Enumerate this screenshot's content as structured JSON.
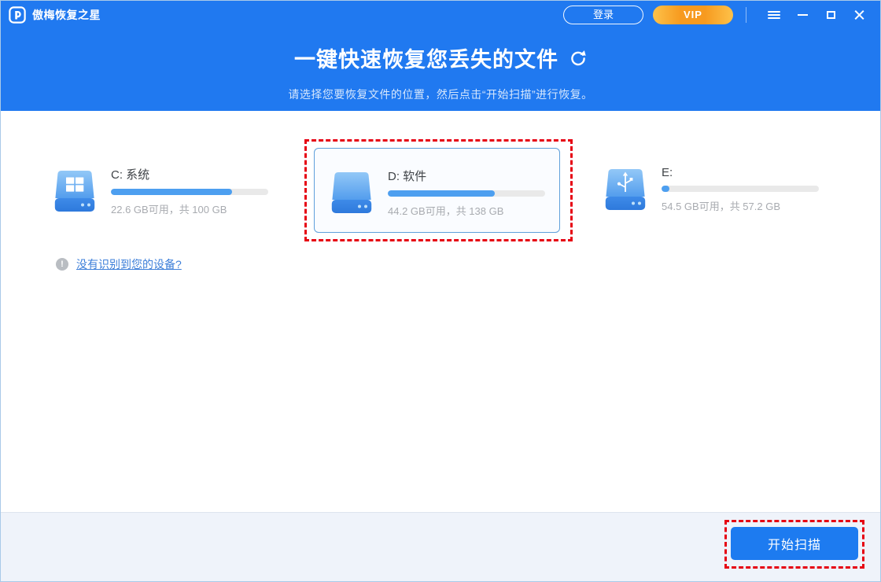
{
  "window": {
    "title": "傲梅恢复之星"
  },
  "titlebar": {
    "login_label": "登录",
    "vip_label": "VIP"
  },
  "banner": {
    "title": "一键快速恢复您丢失的文件",
    "subtitle": "请选择您要恢复文件的位置，然后点击“开始扫描”进行恢复。"
  },
  "drives": [
    {
      "name": "C: 系统",
      "usage_percent": 77,
      "stats": "22.6 GB可用，共 100 GB",
      "icon": "windows-drive-icon",
      "selected": false
    },
    {
      "name": "D: 软件",
      "usage_percent": 68,
      "stats": "44.2 GB可用，共 138 GB",
      "icon": "plain-drive-icon",
      "selected": true
    },
    {
      "name": "E:",
      "usage_percent": 5,
      "stats": "54.5 GB可用，共 57.2 GB",
      "icon": "usb-drive-icon",
      "selected": false
    }
  ],
  "help_link": {
    "label": "没有识别到您的设备?"
  },
  "footer": {
    "scan_button_label": "开始扫描"
  },
  "colors": {
    "header_blue": "#2079F0",
    "bar_fill_blue": "#4D9FF0",
    "annotation_red": "#E60012",
    "vip_orange": "#F79A1F",
    "selected_border": "#5FA0DB"
  }
}
